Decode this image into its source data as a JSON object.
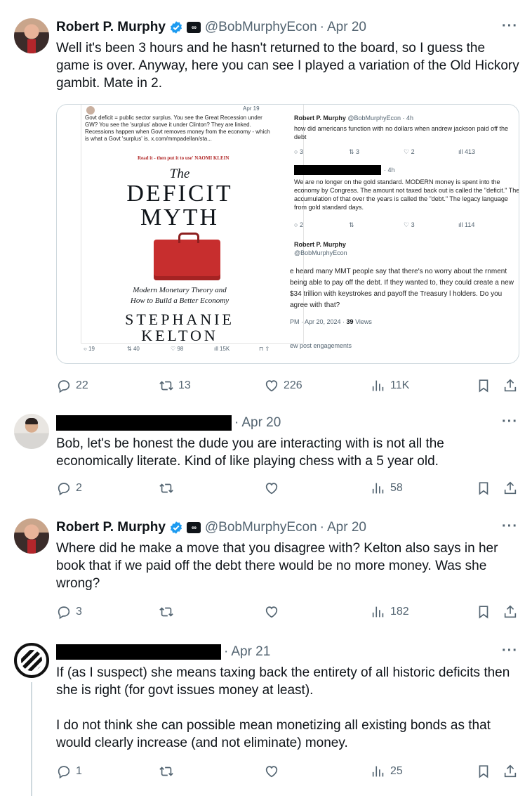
{
  "tweets": [
    {
      "name": "Robert P. Murphy",
      "handle": "@BobMurphyEcon",
      "date": "Apr 20",
      "text": "Well it's been 3 hours and he hasn't returned to the board, so I guess the game is over. Anyway, here you can see I played a variation of the Old Hickory gambit. Mate in 2.",
      "replies": "22",
      "retweets": "13",
      "likes": "226",
      "views": "11K"
    },
    {
      "date": "Apr 20",
      "text": "Bob, let's be honest the dude you are interacting with is not all the economically literate. Kind of like playing chess with a 5 year old.",
      "replies": "2",
      "retweets": "",
      "likes": "",
      "views": "58"
    },
    {
      "name": "Robert P. Murphy",
      "handle": "@BobMurphyEcon",
      "date": "Apr 20",
      "text": "Where did he make a move that you disagree with? Kelton also says in her book that if we paid off the debt there would be no more money. Was she wrong?",
      "replies": "3",
      "retweets": "",
      "likes": "",
      "views": "182"
    },
    {
      "date": "Apr 21",
      "text": "If (as I suspect) she means taxing back the entirety of all historic deficits then she is right (for govt issues money at least).\n\nI do not think she can possible mean monetizing all existing bonds as that would clearly increase (and not eliminate) money.",
      "replies": "1",
      "retweets": "",
      "likes": "",
      "views": "25"
    }
  ],
  "media": {
    "left": {
      "date": "Apr 19",
      "caption": "Govt deficit = public sector surplus. You see the Great Recession under GW? You see the 'surplus' above it under Clinton? They are linked. Recessions happen when Govt removes money from the economy - which is what a Govt 'surplus' is.  x.com/mmpadellan/sta...",
      "blurb": "Read it - then put it to use' NAOMI KLEIN",
      "book_the": "The",
      "book_title1": "DEFICIT",
      "book_title2": "MYTH",
      "book_sub1": "Modern Monetary Theory and",
      "book_sub2": "How to Build a Better Economy",
      "author1": "STEPHANIE",
      "author2": "KELTON",
      "stats": [
        "19",
        "40",
        "98",
        "15K"
      ]
    },
    "right": {
      "t1_name": "Robert P. Murphy",
      "t1_handle": "@BobMurphyEcon · 4h",
      "t1_text": "how did americans function with no dollars when andrew jackson paid off the debt",
      "t1_stats": [
        "3",
        "3",
        "2",
        "413"
      ],
      "t2_time": "· 4h",
      "t2_text": "We are no longer on the gold standard. MODERN money is spent into the economy by Congress. The amount not taxed back out is called the \"deficit.\" The accumulation of that over the years is called the \"debt.\" The legacy language from gold standard days.",
      "t2_stats": [
        "2",
        "",
        "3",
        "114"
      ],
      "t3_name": "Robert P. Murphy",
      "t3_handle": "@BobMurphyEcon",
      "t3_text": "e heard many MMT people say that there's no worry about the rnment being able to pay off the debt. If they wanted to, they could create a new $34 trillion with keystrokes and payoff the Treasury l holders. Do you agree with that?",
      "t3_time": "PM · Apr 20, 2024 · ",
      "t3_views": "39",
      "t3_views_label": " Views",
      "t3_engage": "ew post engagements"
    }
  }
}
